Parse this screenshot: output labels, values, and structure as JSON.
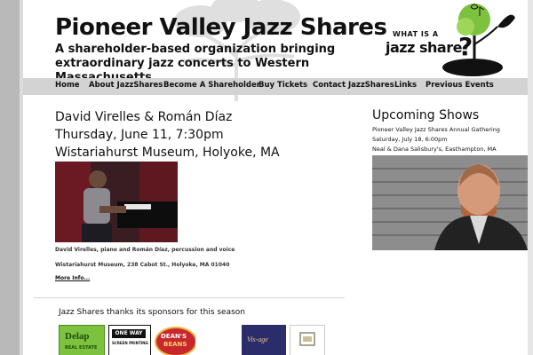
{
  "site": {
    "title": "Pioneer Valley Jazz Shares",
    "tagline": "A shareholder-based organization bringing extraordinary jazz concerts to Western Massachusetts"
  },
  "logo": {
    "line_small": "WHAT IS A",
    "line_main": "jazz share",
    "question_mark": "?"
  },
  "nav": {
    "items": [
      {
        "label": "Home"
      },
      {
        "label": "About JazzShares"
      },
      {
        "label": "Become A Shareholder"
      },
      {
        "label": "Buy Tickets"
      },
      {
        "label": "Contact JazzShares"
      },
      {
        "label": "Links"
      },
      {
        "label": "Previous Events"
      }
    ]
  },
  "post": {
    "title_line1": "David Virelles & Román Díaz",
    "title_line2": "Thursday, June 11, 7:30pm",
    "title_line3": "Wistariahurst Museum, Holyoke, MA",
    "caption_performers": "David Virelles, piano and Román Díaz, percussion and voice",
    "caption_venue": "Wistariahurst Museum, 238 Cabot St., Holyoke, MA 01040",
    "more_link": "More Info..."
  },
  "sponsors": {
    "heading": "Jazz Shares thanks its sponsors for this season",
    "logos": [
      {
        "text": "Delap",
        "subtext": "REAL ESTATE"
      },
      {
        "text": "ONE WAY",
        "subtext": "SCREEN PRINTING"
      },
      {
        "text": "DEAN'S",
        "subtext": "BEANS"
      },
      {
        "text": "Vis-age",
        "subtext": ""
      },
      {
        "text": "",
        "subtext": ""
      }
    ]
  },
  "sidebar": {
    "title": "Upcoming Shows",
    "event_line1": "Pioneer Valley Jazz Shares Annual Gathering",
    "event_line2": "Saturday, July 18, 6:00pm",
    "event_line3": "Neal & Dana Salisbury's, Easthampton, MA"
  },
  "colors": {
    "nav_bg": "#d3d3d3",
    "stripe": "#b9b9b9",
    "logo_green": "#7cc23f",
    "delap_green": "#5a9f2b",
    "deans_red": "#c8282d"
  }
}
